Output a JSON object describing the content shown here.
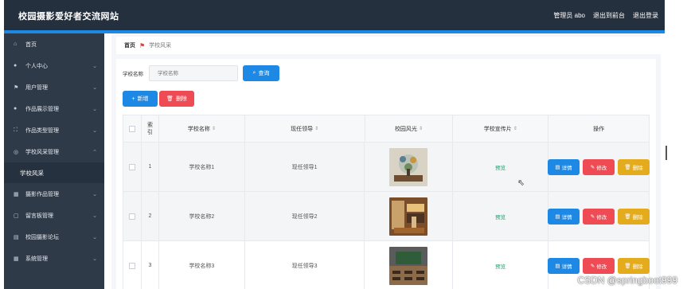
{
  "header": {
    "title": "校园摄影爱好者交流网站",
    "admin": "管理员 abo",
    "back_front": "退出到前台",
    "logout": "退出登录"
  },
  "sidebar": {
    "items": [
      {
        "label": "首页",
        "icon": "home-icon",
        "has_arrow": false
      },
      {
        "label": "个人中心",
        "icon": "user-icon",
        "has_arrow": true
      },
      {
        "label": "用户管理",
        "icon": "flag-icon",
        "has_arrow": true
      },
      {
        "label": "作品展示管理",
        "icon": "user-icon",
        "has_arrow": true
      },
      {
        "label": "作品类型管理",
        "icon": "frame-icon",
        "has_arrow": true
      },
      {
        "label": "学校风采管理",
        "icon": "circle-icon",
        "has_arrow": true
      },
      {
        "label": "学校风采",
        "sub": true
      },
      {
        "label": "摄影作品管理",
        "icon": "grid-icon",
        "has_arrow": true
      },
      {
        "label": "留言板管理",
        "icon": "box-icon",
        "has_arrow": true
      },
      {
        "label": "校园摄影论坛",
        "icon": "doc-icon",
        "has_arrow": true
      },
      {
        "label": "系统管理",
        "icon": "grid-icon",
        "has_arrow": true
      }
    ]
  },
  "breadcrumb": {
    "home": "首页",
    "current": "学校风采"
  },
  "search": {
    "label": "学校名称",
    "placeholder": "学校名称",
    "button": "查询"
  },
  "actions": {
    "add": "新增",
    "delete": "删除"
  },
  "table": {
    "columns": [
      "索引",
      "学校名称",
      "现任领导",
      "校园风光",
      "学校宣传片",
      "操作"
    ],
    "rows": [
      {
        "index": "1",
        "name": "学校名称1",
        "leader": "现任领导1",
        "preview": "预览"
      },
      {
        "index": "2",
        "name": "学校名称2",
        "leader": "现任领导2",
        "preview": "预览"
      },
      {
        "index": "3",
        "name": "学校名称3",
        "leader": "现任领导3",
        "preview": "预览"
      }
    ],
    "ops": {
      "detail": "详情",
      "edit": "修改",
      "remove": "删除"
    }
  },
  "watermark": "CSDN @springboot999",
  "colors": {
    "primary": "#1e88e5",
    "danger": "#ef4b54",
    "warning": "#e4ac1c",
    "sidebar": "#2f3a48",
    "topbar": "#25303e"
  }
}
